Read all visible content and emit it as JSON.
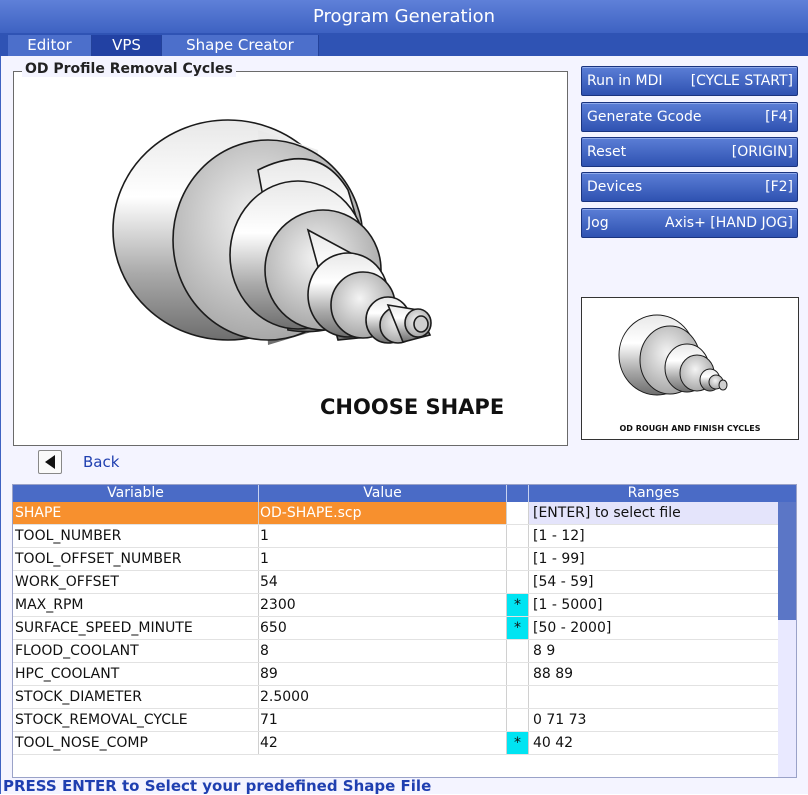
{
  "window": {
    "title": "Program Generation"
  },
  "tabs": [
    {
      "label": "Editor"
    },
    {
      "label": "VPS"
    },
    {
      "label": "Shape Creator"
    }
  ],
  "group": {
    "title": "OD Profile Removal Cycles",
    "preview_caption": "CHOOSE SHAPE"
  },
  "buttons": [
    {
      "label": "Run in MDI",
      "key": "[CYCLE START]"
    },
    {
      "label": "Generate Gcode",
      "key": "[F4]"
    },
    {
      "label": "Reset",
      "key": "[ORIGIN]"
    },
    {
      "label": "Devices",
      "key": "[F2]"
    },
    {
      "label": "Jog",
      "key": "Axis+ [HAND JOG]"
    }
  ],
  "thumbnail": {
    "caption": "OD ROUGH AND FINISH CYCLES"
  },
  "back": {
    "label": "Back",
    "icon": "left-triangle-icon"
  },
  "table": {
    "headers": [
      "Variable",
      "Value",
      "",
      "Ranges"
    ],
    "rows": [
      {
        "variable": "SHAPE",
        "value": "OD-SHAPE.scp",
        "star": "",
        "range": "[ENTER] to select file"
      },
      {
        "variable": "TOOL_NUMBER",
        "value": "1",
        "star": "",
        "range": "[1 - 12]"
      },
      {
        "variable": "TOOL_OFFSET_NUMBER",
        "value": "1",
        "star": "",
        "range": "[1 - 99]"
      },
      {
        "variable": "WORK_OFFSET",
        "value": "54",
        "star": "",
        "range": "[54 - 59]"
      },
      {
        "variable": "MAX_RPM",
        "value": "2300",
        "star": "*",
        "range": "[1 - 5000]"
      },
      {
        "variable": "SURFACE_SPEED_MINUTE",
        "value": "650",
        "star": "*",
        "range": "[50 - 2000]"
      },
      {
        "variable": "FLOOD_COOLANT",
        "value": "8",
        "star": "",
        "range": "8 9"
      },
      {
        "variable": "HPC_COOLANT",
        "value": "89",
        "star": "",
        "range": "88 89"
      },
      {
        "variable": "STOCK_DIAMETER",
        "value": "2.5000",
        "star": "",
        "range": ""
      },
      {
        "variable": "STOCK_REMOVAL_CYCLE",
        "value": "71",
        "star": "",
        "range": "0 71 73"
      },
      {
        "variable": "TOOL_NOSE_COMP",
        "value": "42",
        "star": "*",
        "range": "40 42"
      }
    ],
    "selected_row": 0
  },
  "status": {
    "text": "PRESS ENTER to Select your predefined Shape File"
  },
  "colors": {
    "title_bar": "#4a6bc6",
    "selected_row": "#f7902e",
    "required_marker": "#00e4f2",
    "button": "#3e62c2"
  }
}
